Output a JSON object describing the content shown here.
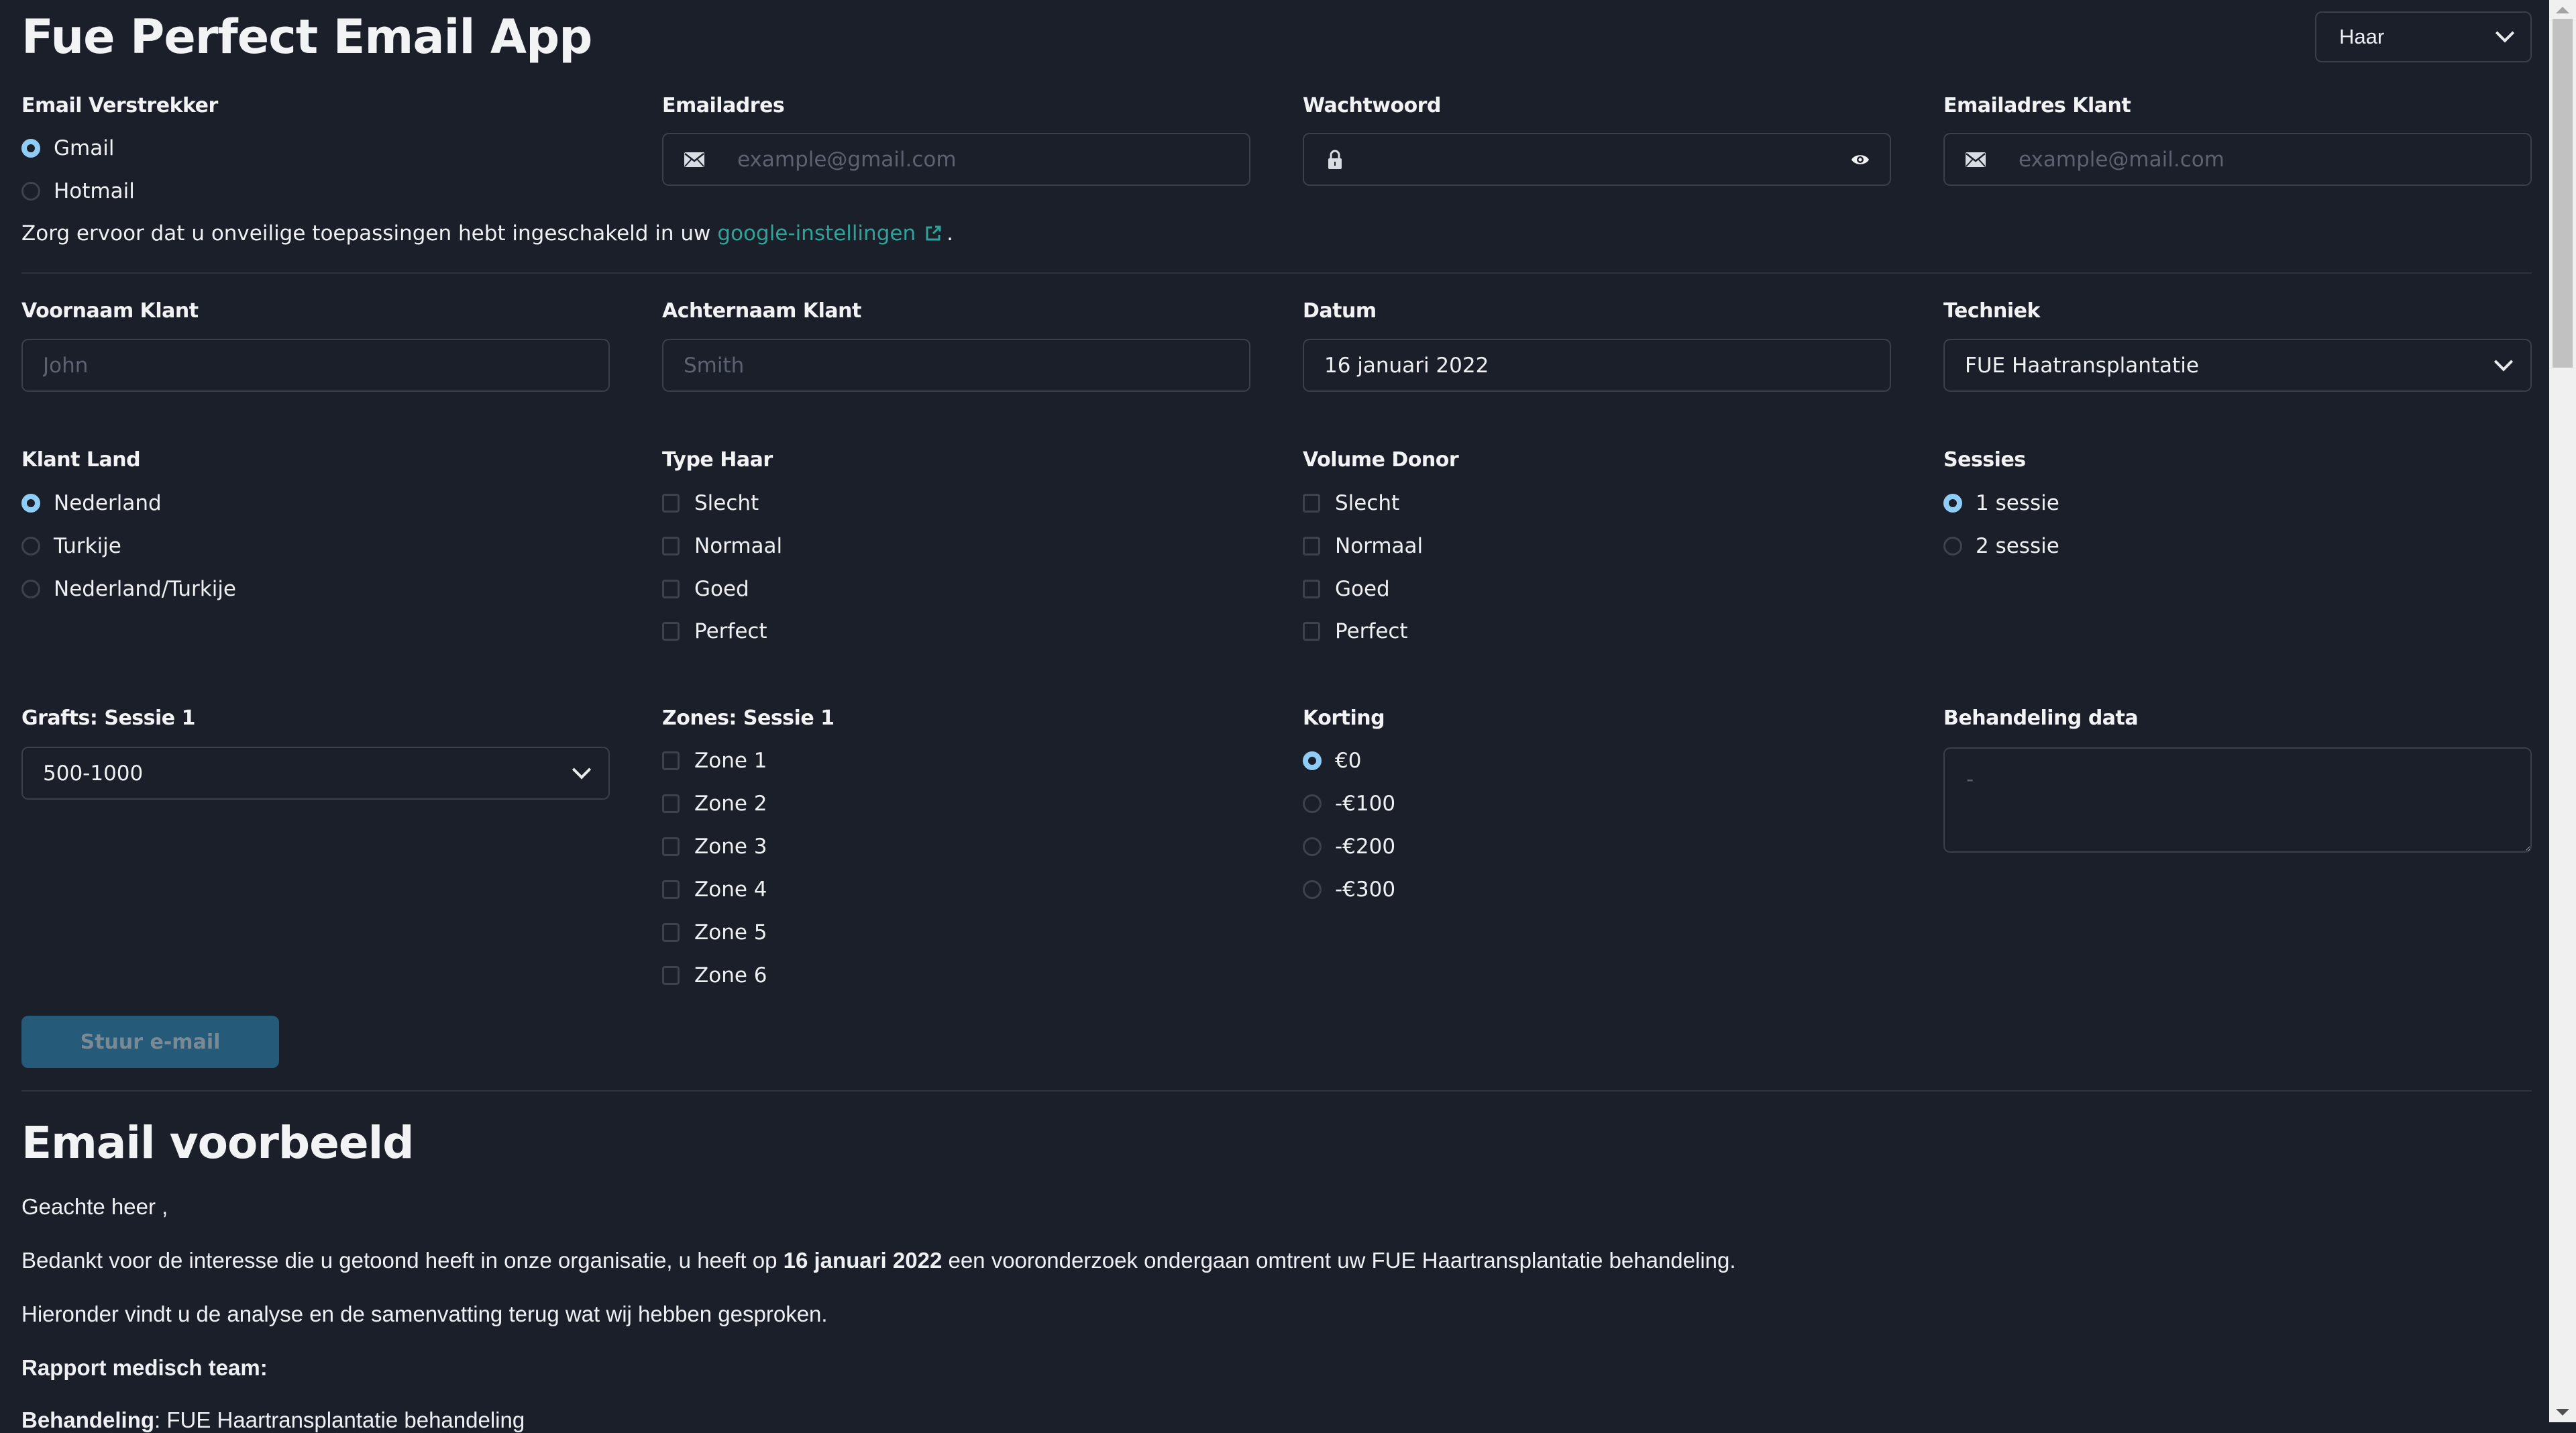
{
  "app": {
    "title": "Fue Perfect Email App",
    "category_select": {
      "value": "Haar"
    }
  },
  "form": {
    "email_provider": {
      "label": "Email Verstrekker",
      "options": [
        {
          "label": "Gmail",
          "selected": true
        },
        {
          "label": "Hotmail",
          "selected": false
        }
      ]
    },
    "email": {
      "label": "Emailadres",
      "placeholder": "example@gmail.com",
      "value": ""
    },
    "password": {
      "label": "Wachtwoord",
      "value": ""
    },
    "client_email": {
      "label": "Emailadres Klant",
      "placeholder": "example@mail.com",
      "value": ""
    },
    "note": {
      "text": "Zorg ervoor dat u onveilige toepassingen hebt ingeschakeld in uw",
      "link_text": "google-instellingen",
      "suffix": "."
    },
    "first_name": {
      "label": "Voornaam Klant",
      "placeholder": "John",
      "value": ""
    },
    "last_name": {
      "label": "Achternaam Klant",
      "placeholder": "Smith",
      "value": ""
    },
    "date": {
      "label": "Datum",
      "value": "16 januari 2022"
    },
    "technique": {
      "label": "Techniek",
      "value": "FUE Haatransplantatie"
    },
    "client_country": {
      "label": "Klant Land",
      "options": [
        {
          "label": "Nederland",
          "selected": true
        },
        {
          "label": "Turkije",
          "selected": false
        },
        {
          "label": "Nederland/Turkije",
          "selected": false
        }
      ]
    },
    "hair_type": {
      "label": "Type Haar",
      "options": [
        {
          "label": "Slecht",
          "checked": false
        },
        {
          "label": "Normaal",
          "checked": false
        },
        {
          "label": "Goed",
          "checked": false
        },
        {
          "label": "Perfect",
          "checked": false
        }
      ]
    },
    "donor_volume": {
      "label": "Volume Donor",
      "options": [
        {
          "label": "Slecht",
          "checked": false
        },
        {
          "label": "Normaal",
          "checked": false
        },
        {
          "label": "Goed",
          "checked": false
        },
        {
          "label": "Perfect",
          "checked": false
        }
      ]
    },
    "sessions": {
      "label": "Sessies",
      "options": [
        {
          "label": "1 sessie",
          "selected": true
        },
        {
          "label": "2 sessie",
          "selected": false
        }
      ]
    },
    "grafts": {
      "label": "Grafts: Sessie 1",
      "value": "500-1000"
    },
    "zones": {
      "label": "Zones: Sessie 1",
      "options": [
        {
          "label": "Zone 1",
          "checked": false
        },
        {
          "label": "Zone 2",
          "checked": false
        },
        {
          "label": "Zone 3",
          "checked": false
        },
        {
          "label": "Zone 4",
          "checked": false
        },
        {
          "label": "Zone 5",
          "checked": false
        },
        {
          "label": "Zone 6",
          "checked": false
        }
      ]
    },
    "discount": {
      "label": "Korting",
      "options": [
        {
          "label": "€0",
          "selected": true
        },
        {
          "label": "-€100",
          "selected": false
        },
        {
          "label": "-€200",
          "selected": false
        },
        {
          "label": "-€300",
          "selected": false
        }
      ]
    },
    "treatment_data": {
      "label": "Behandeling data",
      "placeholder": "-",
      "value": ""
    },
    "send_button": {
      "label": "Stuur e-mail",
      "disabled": true
    }
  },
  "preview": {
    "title": "Email voorbeeld",
    "greeting": "Geachte heer ,",
    "intro_before": "Bedankt voor de interesse die u getoond heeft in onze organisatie, u heeft op ",
    "intro_date": "16 januari 2022",
    "intro_after": " een vooronderzoek ondergaan omtrent uw FUE Haartransplantatie behandeling.",
    "summary": "Hieronder vindt u de analyse en de samenvatting terug wat wij hebben gesproken.",
    "report_heading": "Rapport medisch team:",
    "treatment_label": "Behandeling",
    "treatment_value": ": FUE Haartransplantatie behandeling"
  },
  "colors": {
    "background": "#1b1f2a",
    "accent_radio": "#8fcdf7",
    "link": "#2fa39a",
    "button_disabled": "#255a78",
    "border": "#3a3f4b"
  }
}
